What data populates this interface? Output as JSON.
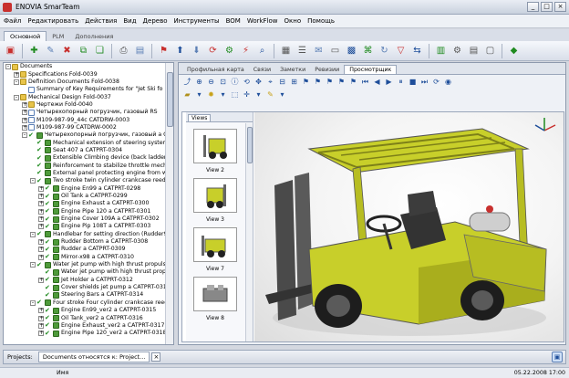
{
  "app": {
    "title": "ENOVIA SmarTeam"
  },
  "window_buttons": [
    "_",
    "□",
    "×"
  ],
  "menu": [
    "Файл",
    "Редактировать",
    "Действия",
    "Вид",
    "Дерево",
    "Инструменты",
    "BOM",
    "WorkFlow",
    "Окно",
    "Помощь"
  ],
  "ribbon_tabs": [
    "Основной",
    "PLM",
    "Дополнения"
  ],
  "tree": [
    {
      "label": "Documents",
      "indent": 0,
      "icon": "folder",
      "exp": "-"
    },
    {
      "label": "Specifications  Fold-0039",
      "indent": 1,
      "icon": "folder",
      "exp": "+"
    },
    {
      "label": "Definition Documents  Fold-0038",
      "indent": 1,
      "icon": "folder",
      "exp": "-"
    },
    {
      "label": "Summary of Key Requirements for \"Jet Ski fo",
      "indent": 2,
      "icon": "doc",
      "exp": ""
    },
    {
      "label": "Mechanical Design  Fold-0037",
      "indent": 1,
      "icon": "folder",
      "exp": "-"
    },
    {
      "label": "Чертежи  Fold-0040",
      "indent": 2,
      "icon": "folder",
      "exp": "+"
    },
    {
      "label": "Четырехопорный погрузчик, газовый  RS",
      "indent": 2,
      "icon": "doc",
      "exp": "+"
    },
    {
      "label": "M109-987-99_44c  CATDRW-0003",
      "indent": 2,
      "icon": "doc",
      "exp": "+"
    },
    {
      "label": "M109-987-99  CATDRW-0002",
      "indent": 2,
      "icon": "doc",
      "exp": "+"
    },
    {
      "label": "Четырехопорный погрузчик, газовый  a C/",
      "indent": 2,
      "icon": "part",
      "exp": "-"
    },
    {
      "label": "Mechanical extension of steering system (",
      "indent": 3,
      "icon": "part",
      "exp": ""
    },
    {
      "label": "Seat 407 a CATPRT-0304",
      "indent": 3,
      "icon": "part",
      "exp": ""
    },
    {
      "label": "Extensible Climbing device (back ladder) a",
      "indent": 3,
      "icon": "part",
      "exp": ""
    },
    {
      "label": "Reinforcement to stabilize throttle mechan",
      "indent": 3,
      "icon": "part",
      "exp": ""
    },
    {
      "label": "External panel protecting engine from wat",
      "indent": 3,
      "icon": "part",
      "exp": ""
    },
    {
      "label": "Two stroke twin cylinder crankcase reed",
      "indent": 3,
      "icon": "part",
      "exp": "-"
    },
    {
      "label": "Engine En99 a CATPRT-0298",
      "indent": 4,
      "icon": "part",
      "exp": "+"
    },
    {
      "label": "Oil Tank a CATPRT-0299",
      "indent": 4,
      "icon": "part",
      "exp": "+"
    },
    {
      "label": "Engine Exhaust a CATPRT-0300",
      "indent": 4,
      "icon": "part",
      "exp": "+"
    },
    {
      "label": "Engine Pipe 120 a CATPRT-0301",
      "indent": 4,
      "icon": "part",
      "exp": "+"
    },
    {
      "label": "Engine Cover 109A a CATPRT-0302",
      "indent": 4,
      "icon": "part",
      "exp": "+"
    },
    {
      "label": "Engine Pip 108T a CATPRT-0303",
      "indent": 4,
      "icon": "part",
      "exp": "+"
    },
    {
      "label": "Handlebar for setting direction (Rudder99-",
      "indent": 3,
      "icon": "part",
      "exp": "-"
    },
    {
      "label": "Rudder Bottom a CATPRT-0308",
      "indent": 4,
      "icon": "part",
      "exp": "+"
    },
    {
      "label": "Rudder a CATPRT-0309",
      "indent": 4,
      "icon": "part",
      "exp": "+"
    },
    {
      "label": "Mirror-x98 a CATPRT-0310",
      "indent": 4,
      "icon": "part",
      "exp": "+"
    },
    {
      "label": "Water jet pump with high thrust propulsion",
      "indent": 3,
      "icon": "part",
      "exp": "-"
    },
    {
      "label": "Water jet pump with high thrust propuls",
      "indent": 4,
      "icon": "part",
      "exp": ""
    },
    {
      "label": "Jet Holder a CATPRT-0312",
      "indent": 4,
      "icon": "part",
      "exp": "+"
    },
    {
      "label": "Cover shields jet pump a CATPRT-0313",
      "indent": 4,
      "icon": "part",
      "exp": ""
    },
    {
      "label": "Steering Bars a CATPRT-0314",
      "indent": 4,
      "icon": "part",
      "exp": ""
    },
    {
      "label": "Four stroke Four cylinder crankcase reed",
      "indent": 3,
      "icon": "part",
      "exp": "-"
    },
    {
      "label": "Engine En99_ver2 a CATPRT-0315",
      "indent": 4,
      "icon": "part",
      "exp": "+"
    },
    {
      "label": "Oil Tank_ver2 a CATPRT-0316",
      "indent": 4,
      "icon": "part",
      "exp": "+"
    },
    {
      "label": "Engine Exhaust_ver2 a CATPRT-0317",
      "indent": 4,
      "icon": "part",
      "exp": "+"
    },
    {
      "label": "Engine Pipe 120_ver2 a CATPRT-0318",
      "indent": 4,
      "icon": "part",
      "exp": "+"
    }
  ],
  "viewer_tabs": [
    "Профильная карта",
    "Связи",
    "Заметки",
    "Ревизии",
    "Просмотрщик"
  ],
  "views_pane": {
    "tab": "Views",
    "items": [
      "View 2",
      "View 3",
      "View 7",
      "View 8"
    ]
  },
  "project_bar": {
    "label": "Projects:",
    "tab": "Documents относятся к: Project..."
  },
  "status_bar": {
    "column_name": "Имя",
    "datetime": "05.22.2008 17:00"
  },
  "colors": {
    "forklift": "#c8cf2a",
    "accent": "#1e4e9a"
  }
}
